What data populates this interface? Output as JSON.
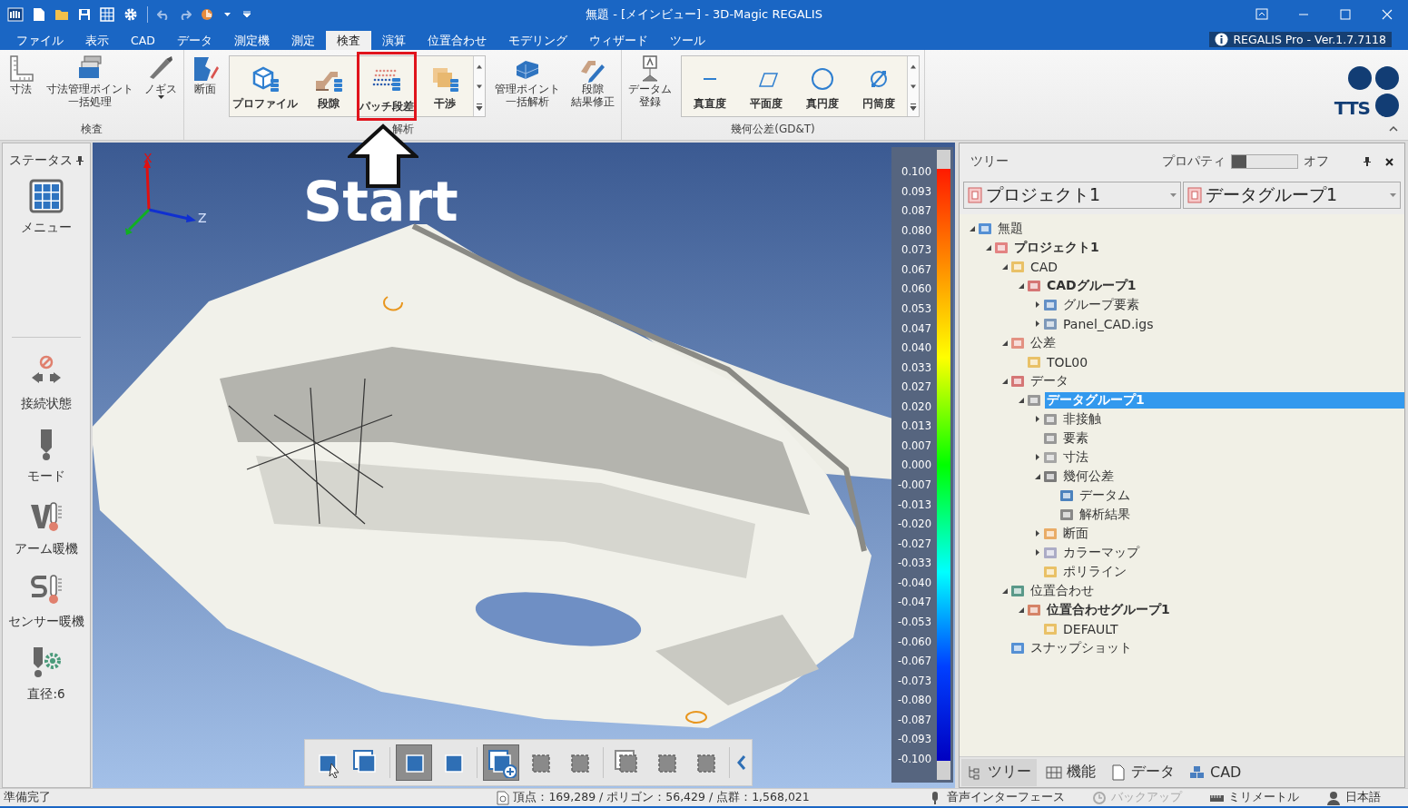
{
  "window": {
    "title": "無題 - [メインビュー] - 3D-Magic REGALIS"
  },
  "menu_tabs": [
    {
      "label": "ファイル",
      "selected": false
    },
    {
      "label": "表示",
      "selected": false
    },
    {
      "label": "CAD",
      "selected": false
    },
    {
      "label": "データ",
      "selected": false
    },
    {
      "label": "測定機",
      "selected": false
    },
    {
      "label": "測定",
      "selected": false
    },
    {
      "label": "検査",
      "selected": true
    },
    {
      "label": "演算",
      "selected": false
    },
    {
      "label": "位置合わせ",
      "selected": false
    },
    {
      "label": "モデリング",
      "selected": false
    },
    {
      "label": "ウィザード",
      "selected": false
    },
    {
      "label": "ツール",
      "selected": false
    }
  ],
  "version_badge": "REGALIS Pro - Ver.1.7.7118",
  "ribbon": [
    {
      "label": "検査",
      "items": [
        {
          "kind": "large",
          "lines": [
            "寸法"
          ],
          "dropdown": false
        },
        {
          "kind": "large",
          "lines": [
            "寸法管理ポイント",
            "一括処理"
          ],
          "dropdown": false
        },
        {
          "kind": "large",
          "lines": [
            "ノギス"
          ],
          "dropdown": true
        }
      ]
    },
    {
      "label": "解析",
      "items": [
        {
          "kind": "large",
          "lines": [
            "断面"
          ],
          "dropdown": false
        },
        {
          "kind": "gallery",
          "items": [
            {
              "label": "プロファイル",
              "highlighted": false
            },
            {
              "label": "段隙",
              "highlighted": false
            },
            {
              "label": "パッチ段差",
              "highlighted": true
            },
            {
              "label": "干渉",
              "highlighted": false
            }
          ]
        },
        {
          "kind": "large",
          "lines": [
            "管理ポイント",
            "一括解析"
          ],
          "dropdown": false
        },
        {
          "kind": "large",
          "lines": [
            "段隙",
            "結果修正"
          ],
          "dropdown": false
        }
      ]
    },
    {
      "label": "幾何公差(GD&T)",
      "items": [
        {
          "kind": "large",
          "lines": [
            "データム",
            "登録"
          ],
          "dropdown": false
        },
        {
          "kind": "gallery",
          "items": [
            {
              "label": "真直度",
              "highlighted": false
            },
            {
              "label": "平面度",
              "highlighted": false
            },
            {
              "label": "真円度",
              "highlighted": false
            },
            {
              "label": "円筒度",
              "highlighted": false
            }
          ]
        }
      ]
    }
  ],
  "logo_text": "TTS",
  "status_panel": {
    "title": "ステータス",
    "items": [
      {
        "label": "メニュー"
      },
      {
        "label": "接続状態"
      },
      {
        "label": "モード"
      },
      {
        "label": "アーム暖機"
      },
      {
        "label": "センサー暖機"
      },
      {
        "label": "直径:6"
      }
    ]
  },
  "viewport": {
    "axis_labels": [
      "X",
      "Z"
    ],
    "annotation": "Start",
    "legend_labels": [
      "0.100",
      "0.093",
      "0.087",
      "0.080",
      "0.073",
      "0.067",
      "0.060",
      "0.053",
      "0.047",
      "0.040",
      "0.033",
      "0.027",
      "0.020",
      "0.013",
      "0.007",
      "0.000",
      "-0.007",
      "-0.013",
      "-0.020",
      "-0.027",
      "-0.033",
      "-0.040",
      "-0.047",
      "-0.053",
      "-0.060",
      "-0.067",
      "-0.073",
      "-0.080",
      "-0.087",
      "-0.093",
      "-0.100"
    ],
    "tools": [
      {
        "selected": false,
        "disabled": false
      },
      {
        "selected": false,
        "disabled": false
      },
      {
        "selected": true,
        "disabled": false
      },
      {
        "selected": false,
        "disabled": false
      },
      {
        "selected": true,
        "disabled": false
      },
      {
        "selected": false,
        "disabled": true
      },
      {
        "selected": false,
        "disabled": true
      },
      {
        "selected": false,
        "disabled": true
      },
      {
        "selected": false,
        "disabled": true
      },
      {
        "selected": false,
        "disabled": true
      }
    ]
  },
  "tree_panel": {
    "title": "ツリー",
    "properties": {
      "label": "プロパティ",
      "on": false,
      "state_label": "オフ"
    },
    "dropdowns": [
      {
        "value": "プロジェクト1"
      },
      {
        "value": "データグループ1"
      }
    ],
    "tree": [
      {
        "label": "無題",
        "expanded": true,
        "selected": false,
        "children": [
          {
            "label": "プロジェクト1",
            "bold": true,
            "expanded": true,
            "selected": false,
            "children": [
              {
                "label": "CAD",
                "expanded": true,
                "selected": false,
                "children": [
                  {
                    "label": "CADグループ1",
                    "bold": true,
                    "expanded": true,
                    "selected": false,
                    "children": [
                      {
                        "label": "グループ要素",
                        "expanded": false,
                        "selected": false
                      },
                      {
                        "label": "Panel_CAD.igs",
                        "expanded": false,
                        "selected": false
                      }
                    ]
                  }
                ]
              },
              {
                "label": "公差",
                "expanded": true,
                "selected": false,
                "children": [
                  {
                    "label": "TOL00",
                    "selected": false
                  }
                ]
              },
              {
                "label": "データ",
                "expanded": true,
                "selected": false,
                "children": [
                  {
                    "label": "データグループ1",
                    "bold": true,
                    "expanded": true,
                    "selected": true,
                    "children": [
                      {
                        "label": "非接触",
                        "expanded": false,
                        "selected": false
                      },
                      {
                        "label": "要素",
                        "selected": false
                      },
                      {
                        "label": "寸法",
                        "expanded": false,
                        "selected": false
                      },
                      {
                        "label": "幾何公差",
                        "expanded": true,
                        "selected": false,
                        "children": [
                          {
                            "label": "データム",
                            "selected": false
                          },
                          {
                            "label": "解析結果",
                            "selected": false
                          }
                        ]
                      },
                      {
                        "label": "断面",
                        "expanded": false,
                        "selected": false
                      },
                      {
                        "label": "カラーマップ",
                        "expanded": false,
                        "selected": false
                      },
                      {
                        "label": "ポリライン",
                        "selected": false
                      }
                    ]
                  }
                ]
              },
              {
                "label": "位置合わせ",
                "expanded": true,
                "selected": false,
                "children": [
                  {
                    "label": "位置合わせグループ1",
                    "bold": true,
                    "expanded": true,
                    "selected": false,
                    "children": [
                      {
                        "label": "DEFAULT",
                        "selected": false
                      }
                    ]
                  }
                ]
              },
              {
                "label": "スナップショット",
                "selected": false
              }
            ]
          }
        ]
      }
    ],
    "bottom_tabs": [
      {
        "label": "ツリー",
        "selected": true
      },
      {
        "label": "機能",
        "selected": false
      },
      {
        "label": "データ",
        "selected": false
      },
      {
        "label": "CAD",
        "selected": false
      }
    ]
  },
  "status_bar": {
    "message": "準備完了",
    "stats": "頂点：169,289 / ポリゴン：56,429 / 点群：1,568,021",
    "items": [
      {
        "label": "音声インターフェース",
        "disabled": false
      },
      {
        "label": "バックアップ",
        "disabled": true
      },
      {
        "label": "ミリメートル",
        "disabled": false
      },
      {
        "label": "日本語",
        "disabled": false
      }
    ]
  }
}
